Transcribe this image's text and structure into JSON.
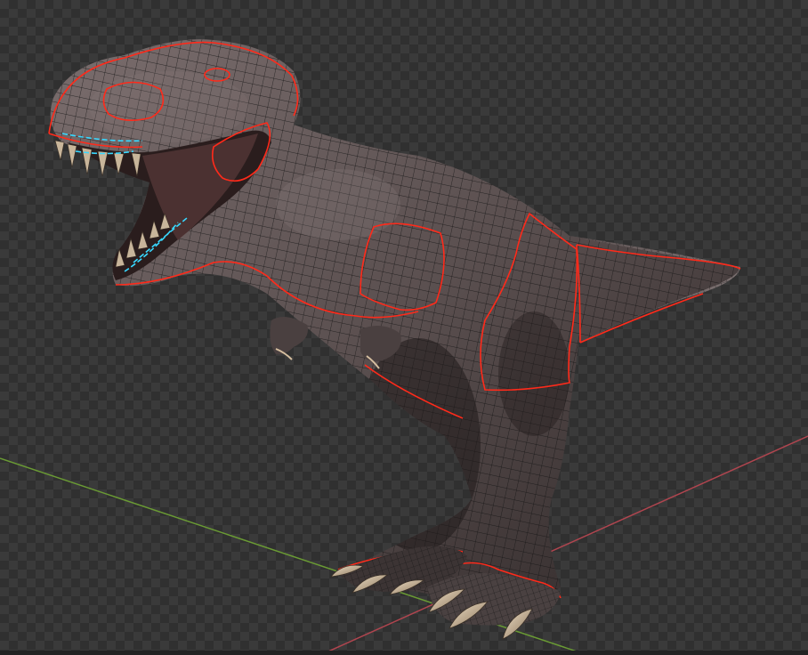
{
  "viewport": {
    "mode": "3d-viewport",
    "object": "tyrannosaurus-model",
    "display": "wireframe-overlay",
    "background": "checkerboard",
    "colors": {
      "checker_light": "#3a3a3a",
      "checker_dark": "#303030",
      "x_axis": "#b0454f",
      "y_axis": "#6a9a34",
      "seam": "#ff2a1a",
      "selected_edge": "#38d8ff",
      "mesh_wire": "#141414",
      "skin_light": "#7a6d6d",
      "skin_dark": "#2e2727",
      "claw": "#d6bfa0"
    },
    "icons": [
      "axis-x-line",
      "axis-y-line",
      "seam-lines",
      "wireframe-mesh"
    ]
  }
}
